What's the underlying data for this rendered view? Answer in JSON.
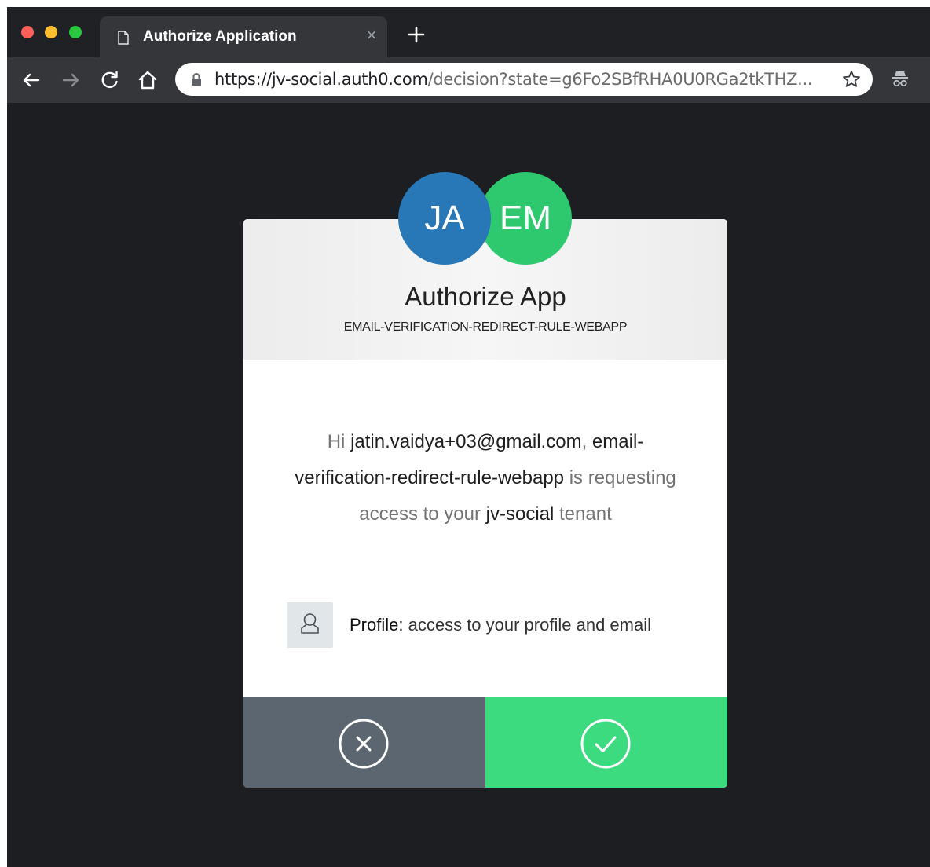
{
  "browser": {
    "tab_title": "Authorize Application",
    "tab_close": "×",
    "url_host": "https://jv-social.auth0.com",
    "url_path": "/decision?state=g6Fo2SBfRHA0U0RGa2tkTHZ..."
  },
  "consent": {
    "avatars": [
      {
        "initials": "JA",
        "color": "#2878b8"
      },
      {
        "initials": "EM",
        "color": "#2ec86f"
      }
    ],
    "title": "Authorize App",
    "app_name": "EMAIL-VERIFICATION-REDIRECT-RULE-WEBAPP",
    "message": {
      "greeting": "Hi",
      "user": "jatin.vaidya+03@gmail.com",
      "comma": ",",
      "client": "email-verification-redirect-rule-webapp",
      "requesting": "is requesting access to your",
      "tenant_name": "jv-social",
      "tenant_word": "tenant"
    },
    "scope": {
      "name": "Profile:",
      "description": "access to your profile and email",
      "icon": "user-icon"
    },
    "deny_icon": "close-circle-icon",
    "allow_icon": "check-circle-icon",
    "colors": {
      "deny": "#5c6670",
      "allow": "#3ddb7f",
      "page_background": "#1d1e22"
    }
  }
}
